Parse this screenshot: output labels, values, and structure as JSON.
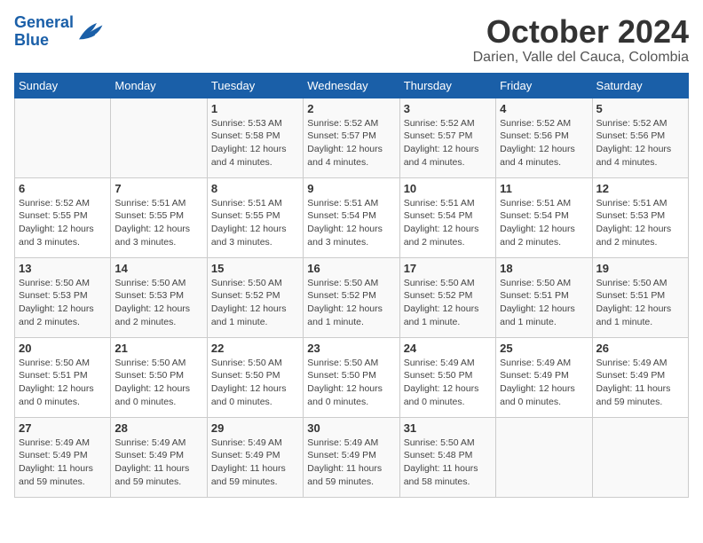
{
  "logo": {
    "line1": "General",
    "line2": "Blue"
  },
  "title": "October 2024",
  "subtitle": "Darien, Valle del Cauca, Colombia",
  "weekdays": [
    "Sunday",
    "Monday",
    "Tuesday",
    "Wednesday",
    "Thursday",
    "Friday",
    "Saturday"
  ],
  "weeks": [
    [
      {
        "day": "",
        "info": ""
      },
      {
        "day": "",
        "info": ""
      },
      {
        "day": "1",
        "info": "Sunrise: 5:53 AM\nSunset: 5:58 PM\nDaylight: 12 hours and 4 minutes."
      },
      {
        "day": "2",
        "info": "Sunrise: 5:52 AM\nSunset: 5:57 PM\nDaylight: 12 hours and 4 minutes."
      },
      {
        "day": "3",
        "info": "Sunrise: 5:52 AM\nSunset: 5:57 PM\nDaylight: 12 hours and 4 minutes."
      },
      {
        "day": "4",
        "info": "Sunrise: 5:52 AM\nSunset: 5:56 PM\nDaylight: 12 hours and 4 minutes."
      },
      {
        "day": "5",
        "info": "Sunrise: 5:52 AM\nSunset: 5:56 PM\nDaylight: 12 hours and 4 minutes."
      }
    ],
    [
      {
        "day": "6",
        "info": "Sunrise: 5:52 AM\nSunset: 5:55 PM\nDaylight: 12 hours and 3 minutes."
      },
      {
        "day": "7",
        "info": "Sunrise: 5:51 AM\nSunset: 5:55 PM\nDaylight: 12 hours and 3 minutes."
      },
      {
        "day": "8",
        "info": "Sunrise: 5:51 AM\nSunset: 5:55 PM\nDaylight: 12 hours and 3 minutes."
      },
      {
        "day": "9",
        "info": "Sunrise: 5:51 AM\nSunset: 5:54 PM\nDaylight: 12 hours and 3 minutes."
      },
      {
        "day": "10",
        "info": "Sunrise: 5:51 AM\nSunset: 5:54 PM\nDaylight: 12 hours and 2 minutes."
      },
      {
        "day": "11",
        "info": "Sunrise: 5:51 AM\nSunset: 5:54 PM\nDaylight: 12 hours and 2 minutes."
      },
      {
        "day": "12",
        "info": "Sunrise: 5:51 AM\nSunset: 5:53 PM\nDaylight: 12 hours and 2 minutes."
      }
    ],
    [
      {
        "day": "13",
        "info": "Sunrise: 5:50 AM\nSunset: 5:53 PM\nDaylight: 12 hours and 2 minutes."
      },
      {
        "day": "14",
        "info": "Sunrise: 5:50 AM\nSunset: 5:53 PM\nDaylight: 12 hours and 2 minutes."
      },
      {
        "day": "15",
        "info": "Sunrise: 5:50 AM\nSunset: 5:52 PM\nDaylight: 12 hours and 1 minute."
      },
      {
        "day": "16",
        "info": "Sunrise: 5:50 AM\nSunset: 5:52 PM\nDaylight: 12 hours and 1 minute."
      },
      {
        "day": "17",
        "info": "Sunrise: 5:50 AM\nSunset: 5:52 PM\nDaylight: 12 hours and 1 minute."
      },
      {
        "day": "18",
        "info": "Sunrise: 5:50 AM\nSunset: 5:51 PM\nDaylight: 12 hours and 1 minute."
      },
      {
        "day": "19",
        "info": "Sunrise: 5:50 AM\nSunset: 5:51 PM\nDaylight: 12 hours and 1 minute."
      }
    ],
    [
      {
        "day": "20",
        "info": "Sunrise: 5:50 AM\nSunset: 5:51 PM\nDaylight: 12 hours and 0 minutes."
      },
      {
        "day": "21",
        "info": "Sunrise: 5:50 AM\nSunset: 5:50 PM\nDaylight: 12 hours and 0 minutes."
      },
      {
        "day": "22",
        "info": "Sunrise: 5:50 AM\nSunset: 5:50 PM\nDaylight: 12 hours and 0 minutes."
      },
      {
        "day": "23",
        "info": "Sunrise: 5:50 AM\nSunset: 5:50 PM\nDaylight: 12 hours and 0 minutes."
      },
      {
        "day": "24",
        "info": "Sunrise: 5:49 AM\nSunset: 5:50 PM\nDaylight: 12 hours and 0 minutes."
      },
      {
        "day": "25",
        "info": "Sunrise: 5:49 AM\nSunset: 5:49 PM\nDaylight: 12 hours and 0 minutes."
      },
      {
        "day": "26",
        "info": "Sunrise: 5:49 AM\nSunset: 5:49 PM\nDaylight: 11 hours and 59 minutes."
      }
    ],
    [
      {
        "day": "27",
        "info": "Sunrise: 5:49 AM\nSunset: 5:49 PM\nDaylight: 11 hours and 59 minutes."
      },
      {
        "day": "28",
        "info": "Sunrise: 5:49 AM\nSunset: 5:49 PM\nDaylight: 11 hours and 59 minutes."
      },
      {
        "day": "29",
        "info": "Sunrise: 5:49 AM\nSunset: 5:49 PM\nDaylight: 11 hours and 59 minutes."
      },
      {
        "day": "30",
        "info": "Sunrise: 5:49 AM\nSunset: 5:49 PM\nDaylight: 11 hours and 59 minutes."
      },
      {
        "day": "31",
        "info": "Sunrise: 5:50 AM\nSunset: 5:48 PM\nDaylight: 11 hours and 58 minutes."
      },
      {
        "day": "",
        "info": ""
      },
      {
        "day": "",
        "info": ""
      }
    ]
  ]
}
